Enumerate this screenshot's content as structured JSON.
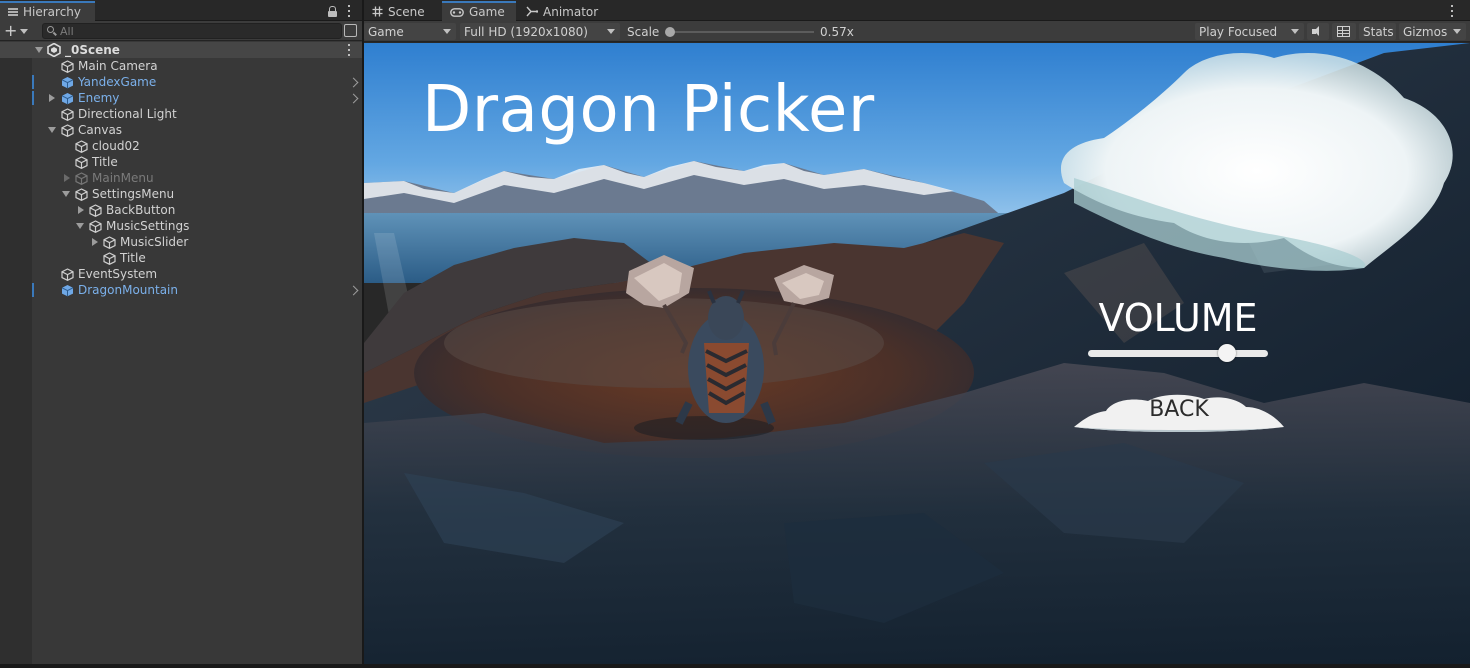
{
  "hierarchy": {
    "tab_label": "Hierarchy",
    "search_placeholder": "All",
    "scene_name": "_0Scene",
    "items": [
      {
        "label": "Main Camera"
      },
      {
        "label": "YandexGame"
      },
      {
        "label": "Enemy"
      },
      {
        "label": "Directional Light"
      },
      {
        "label": "Canvas"
      },
      {
        "label": "cloud02"
      },
      {
        "label": "Title"
      },
      {
        "label": "MainMenu"
      },
      {
        "label": "SettingsMenu"
      },
      {
        "label": "BackButton"
      },
      {
        "label": "MusicSettings"
      },
      {
        "label": "MusicSlider"
      },
      {
        "label": "Title"
      },
      {
        "label": "EventSystem"
      },
      {
        "label": "DragonMountain"
      }
    ]
  },
  "tabs": [
    {
      "label": "Scene",
      "icon": "grid-hash-icon"
    },
    {
      "label": "Game",
      "icon": "gamepad-icon",
      "active": true
    },
    {
      "label": "Animator",
      "icon": "animator-icon"
    }
  ],
  "game_toolbar": {
    "display": "Game",
    "resolution": "Full HD (1920x1080)",
    "scale_label": "Scale",
    "scale_value": "0.57x",
    "play_mode": "Play Focused",
    "stats": "Stats",
    "gizmos": "Gizmos"
  },
  "game": {
    "title": "Dragon Picker",
    "volume_label": "VOLUME",
    "volume_level": 0.77,
    "back_label": "BACK"
  },
  "colors": {
    "prefab_blue": "#7bb0ea",
    "active_tab_accent": "#3a79bb",
    "panel_bg": "#383838"
  }
}
